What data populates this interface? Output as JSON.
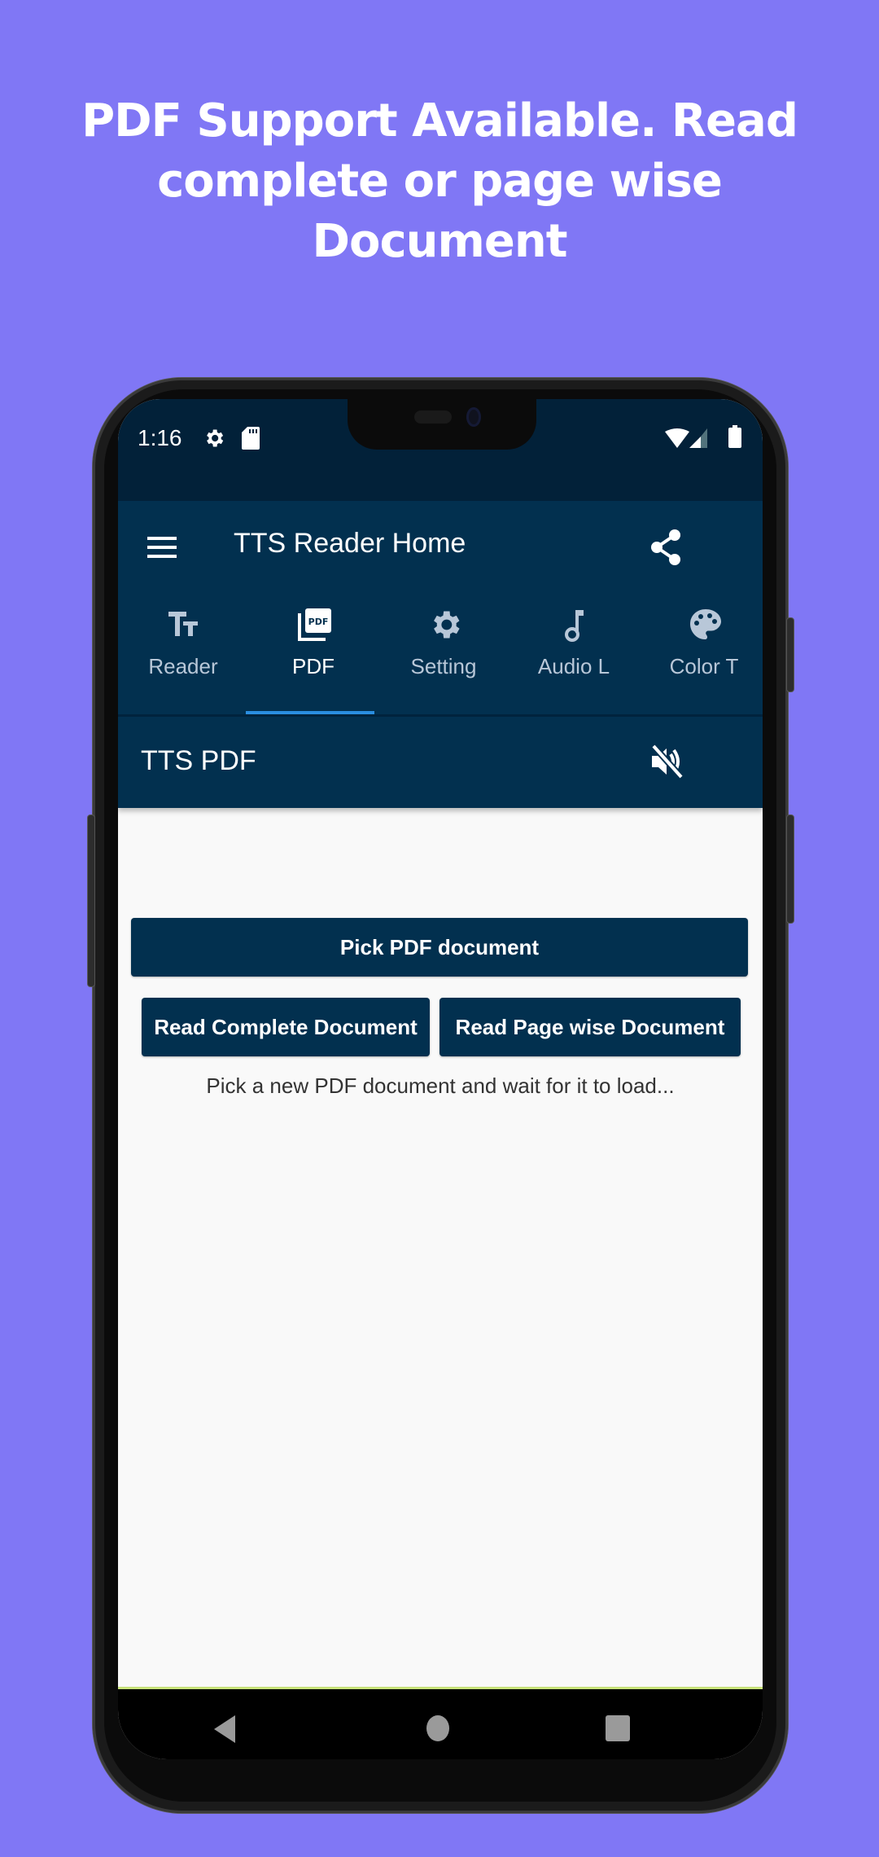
{
  "headline": {
    "line1": "PDF Support Available. Read",
    "line2": "complete or page wise",
    "line3": "Document"
  },
  "status_bar": {
    "time": "1:16",
    "left_icons": [
      "settings-icon",
      "sd-card-icon"
    ],
    "right_icons": [
      "wifi-icon",
      "signal-icon",
      "battery-icon"
    ]
  },
  "app_bar": {
    "title": "TTS Reader Home",
    "menu_icon": "hamburger-menu-icon",
    "action_icon": "share-icon"
  },
  "tabs": [
    {
      "label": "Reader",
      "icon": "text-size-icon",
      "active": false
    },
    {
      "label": "PDF",
      "icon": "pdf-icon",
      "active": true
    },
    {
      "label": "Setting",
      "icon": "gear-icon",
      "active": false
    },
    {
      "label": "Audio L",
      "icon": "music-note-icon",
      "active": false
    },
    {
      "label": "Color T",
      "icon": "palette-icon",
      "active": false
    }
  ],
  "sub_bar": {
    "title": "TTS PDF",
    "action_icon": "volume-off-icon"
  },
  "content": {
    "pick_button": "Pick PDF document",
    "read_complete_button": "Read Complete Document",
    "read_page_button": "Read Page wise Document",
    "hint": "Pick a new PDF document and wait for it to load..."
  },
  "nav_bar": {
    "back": "back-icon",
    "home": "home-icon",
    "recents": "recents-icon"
  },
  "colors": {
    "background": "#8077f5",
    "primary": "#02304f",
    "status_bar": "#022139",
    "tab_indicator": "#2a8ee0",
    "content_bg": "#f9f9f9"
  }
}
